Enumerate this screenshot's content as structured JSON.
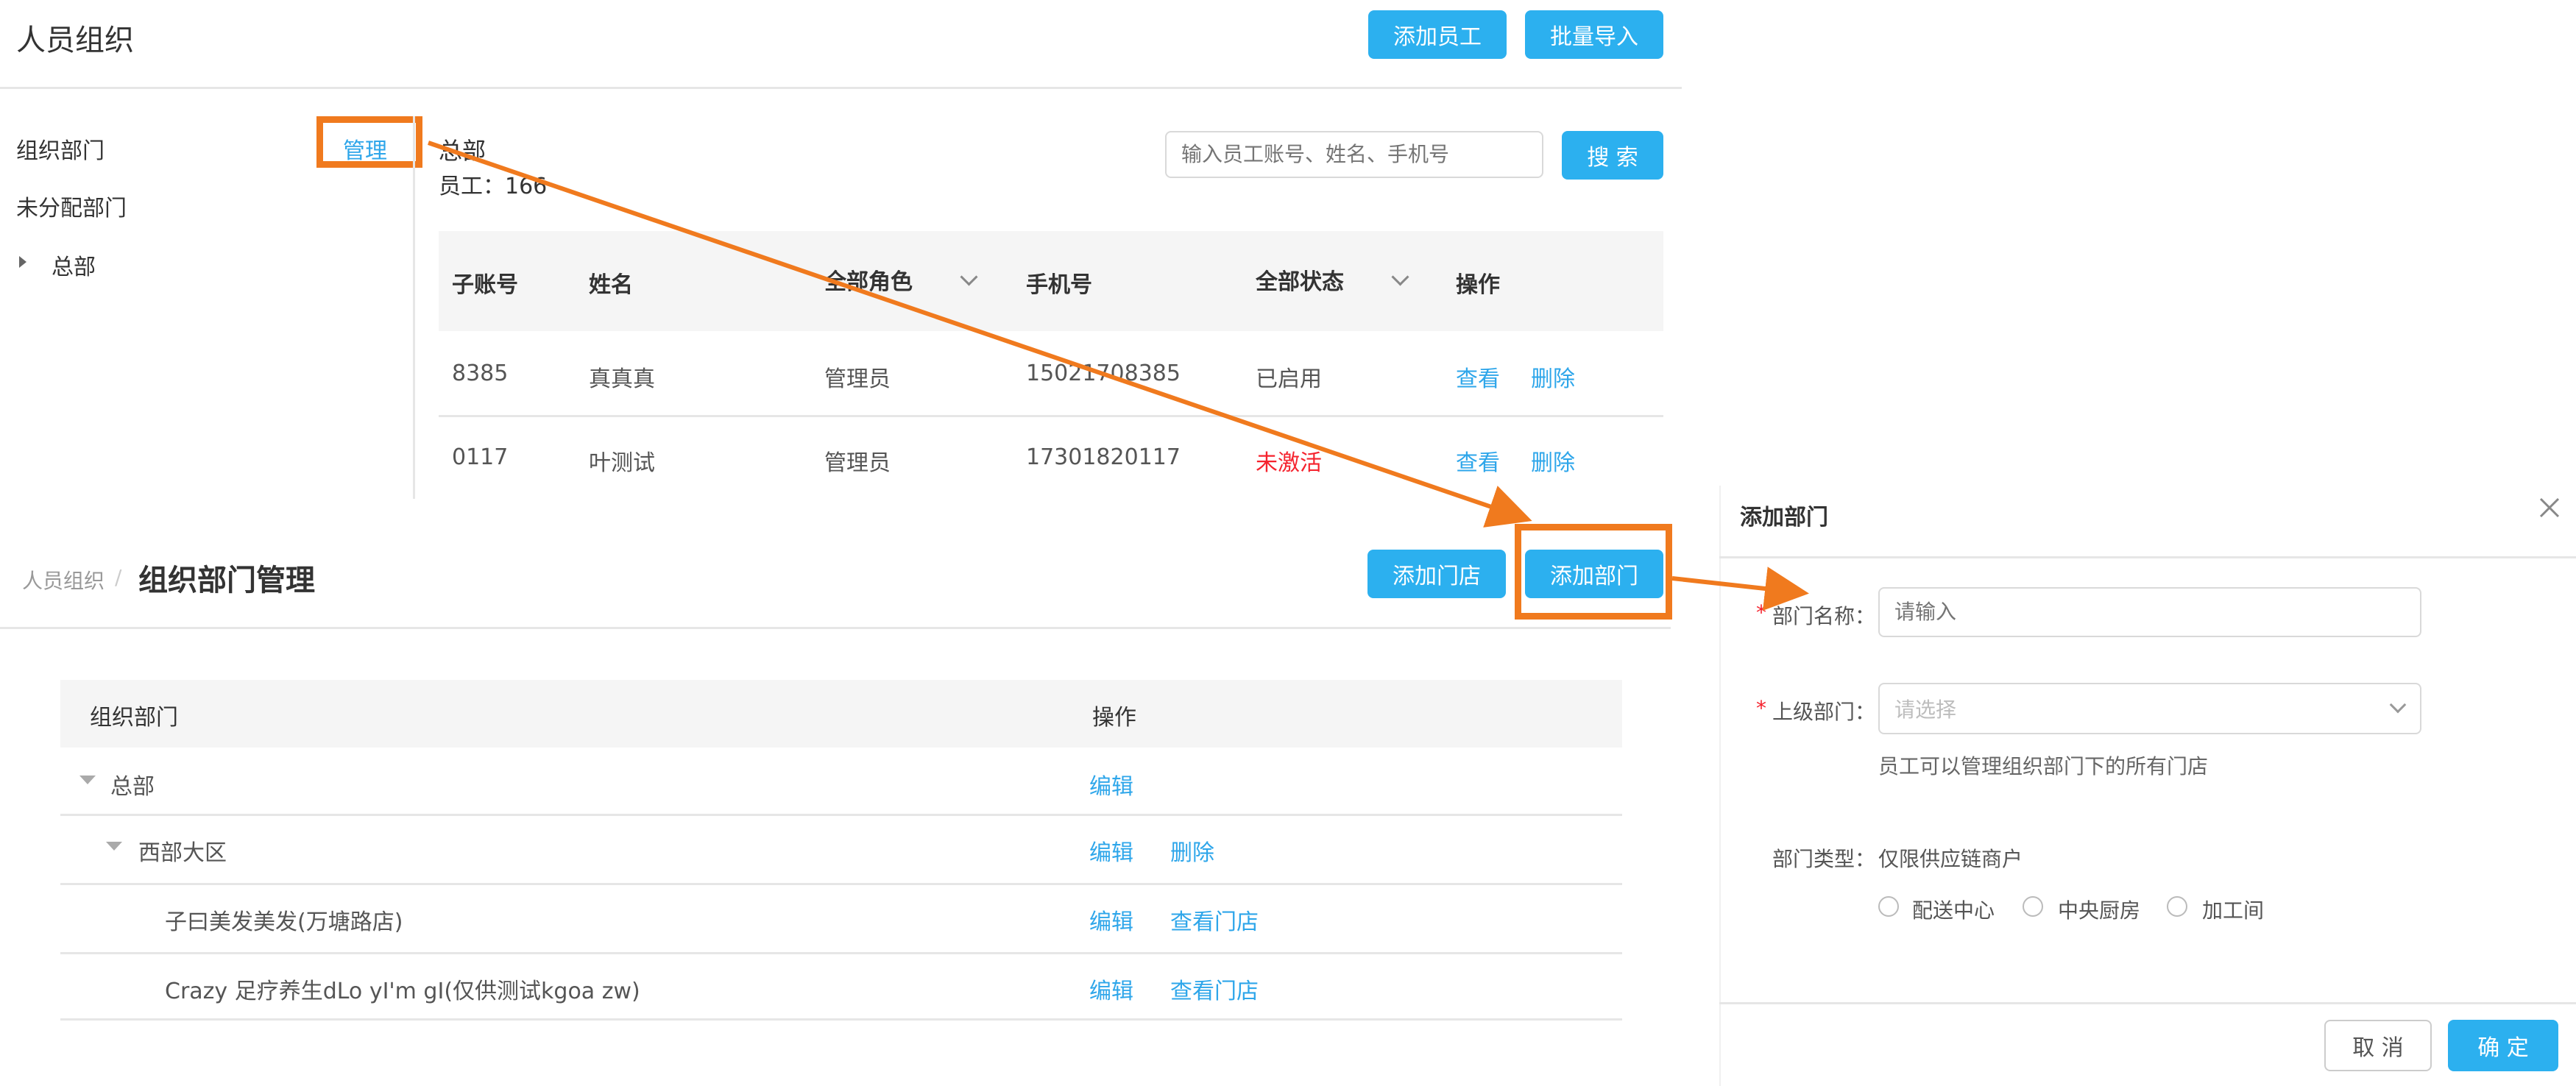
{
  "top": {
    "title": "人员组织",
    "add_employee": "添加员工",
    "batch_import": "批量导入",
    "sidebar": {
      "org_dept": "组织部门",
      "manage": "管理",
      "unassigned": "未分配部门",
      "hq": "总部"
    },
    "dept": {
      "name": "总部",
      "employees": "员工：166"
    },
    "search": {
      "placeholder": "输入员工账号、姓名、手机号",
      "button": "搜 索"
    },
    "table": {
      "headers": [
        "子账号",
        "姓名",
        "全部角色",
        "手机号",
        "全部状态",
        "操作"
      ],
      "rows": [
        {
          "account": "8385",
          "name": "真真真",
          "role": "管理员",
          "phone": "15021708385",
          "status": "已启用",
          "view": "查看",
          "delete": "删除"
        },
        {
          "account": "0117",
          "name": "叶测试",
          "role": "管理员",
          "phone": "17301820117",
          "status": "未激活",
          "view": "查看",
          "delete": "删除"
        }
      ]
    }
  },
  "mid": {
    "breadcrumb": "人员组织",
    "separator": "/",
    "title": "组织部门管理",
    "add_store": "添加门店",
    "add_dept": "添加部门",
    "table": {
      "headers": [
        "组织部门",
        "操作"
      ],
      "rows": [
        {
          "name": "总部",
          "actions": [
            "编辑"
          ]
        },
        {
          "name": "西部大区",
          "actions": [
            "编辑",
            "删除"
          ]
        },
        {
          "name": "子曰美发美发(万塘路店)",
          "actions": [
            "编辑",
            "查看门店"
          ]
        },
        {
          "name": "Crazy 足疗养生dLo yI'm gI(仅供测试kgoa zw)",
          "actions": [
            "编辑",
            "查看门店"
          ]
        }
      ]
    }
  },
  "dialog": {
    "title": "添加部门",
    "name_label": "部门名称：",
    "name_placeholder": "请输入",
    "parent_label": "上级部门：",
    "parent_placeholder": "请选择",
    "parent_hint": "员工可以管理组织部门下的所有门店",
    "type_label": "部门类型：",
    "type_value": "仅限供应链商户",
    "options": [
      "配送中心",
      "中央厨房",
      "加工间"
    ],
    "cancel": "取 消",
    "confirm": "确 定"
  },
  "colors": {
    "accent": "#2cb0ef",
    "highlight": "#f07a1e",
    "status_inactive": "#f5222d",
    "required": "#f5222d"
  }
}
